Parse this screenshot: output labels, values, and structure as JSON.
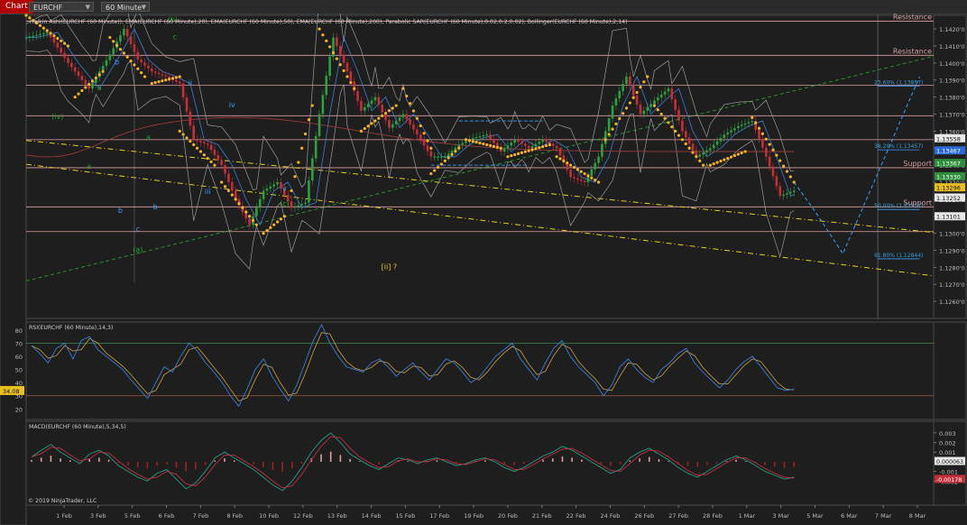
{
  "toolbar": {
    "chart_button": "Chart",
    "instrument": "EURCHF",
    "interval": "60 Minute"
  },
  "copyright": "© 2019 NinjaTrader, LLC",
  "colors": {
    "background": "#1e1e1e",
    "panel_border": "#4a4a4a",
    "sar": "#f5b324",
    "ema20": "#3a7dd8",
    "ema200": "#9a3a3a",
    "bollinger": "#9a9a9a",
    "candle_up": "#2ea043",
    "candle_down": "#c42f3a",
    "resistance_line": "#e0a0a0",
    "fib_line": "#3aa0ff",
    "trend_yellow": "#e8d020",
    "trend_green": "#2aa02a",
    "rsi_line": "#3a7dd8",
    "rsi_signal": "#d0a040",
    "macd_pos": "#e0a0a0",
    "macd_neg": "#a02020",
    "price_marker": "#ffffff",
    "support_marker": "#2ea043",
    "red_marker": "#c42f3a"
  },
  "chart_data": {
    "type": "candlestick",
    "title": "Heikin Ashi(EURCHF (60 Minute)), EMA(EURCHF (60 Minute),20), EMA(EURCHF (60 Minute),50), EMA(EURCHF (60 Minute),200), Parabolic SAR(EURCHF (60 Minute),0.02,0.2,0.02), Bollinger(EURCHF (60 Minute),2,14)",
    "x_labels": [
      "1 Feb",
      "3 Feb",
      "5 Feb",
      "6 Feb",
      "7 Feb",
      "8 Feb",
      "10 Feb",
      "12 Feb",
      "13 Feb",
      "14 Feb",
      "15 Feb",
      "17 Feb",
      "19 Feb",
      "20 Feb",
      "21 Feb",
      "22 Feb",
      "24 Feb",
      "26 Feb",
      "27 Feb",
      "28 Feb",
      "1 Mar",
      "3 Mar",
      "5 Mar",
      "6 Mar",
      "7 Mar",
      "8 Mar"
    ],
    "price_axis": {
      "ylim": [
        1.125,
        1.1428
      ],
      "ticks": [
        "1.1420'0",
        "1.1410'0",
        "1.1400'0",
        "1.1390'0",
        "1.1380'0",
        "1.1370'0",
        "1.1360'0",
        "1.1350'0",
        "1.1340'0",
        "1.1330'0",
        "1.1320'0",
        "1.1310'0",
        "1.1300'0",
        "1.1290'0",
        "1.1280'0",
        "1.1270'0",
        "1.1260'0"
      ],
      "tick_values": [
        1.142,
        1.141,
        1.14,
        1.139,
        1.138,
        1.137,
        1.136,
        1.135,
        1.134,
        1.133,
        1.132,
        1.131,
        1.13,
        1.129,
        1.128,
        1.127,
        1.126
      ]
    },
    "price_path": [
      [
        0,
        1.1415
      ],
      [
        3,
        1.1418
      ],
      [
        6,
        1.14
      ],
      [
        9,
        1.1385
      ],
      [
        12,
        1.1405
      ],
      [
        14,
        1.142
      ],
      [
        16,
        1.1402
      ],
      [
        18,
        1.1395
      ],
      [
        20,
        1.1392
      ],
      [
        22,
        1.1388
      ],
      [
        24,
        1.1355
      ],
      [
        26,
        1.1352
      ],
      [
        28,
        1.134
      ],
      [
        30,
        1.132
      ],
      [
        32,
        1.1305
      ],
      [
        34,
        1.1325
      ],
      [
        36,
        1.133
      ],
      [
        38,
        1.1315
      ],
      [
        40,
        1.1318
      ],
      [
        42,
        1.137
      ],
      [
        44,
        1.1415
      ],
      [
        46,
        1.1395
      ],
      [
        48,
        1.1372
      ],
      [
        50,
        1.138
      ],
      [
        52,
        1.1362
      ],
      [
        54,
        1.137
      ],
      [
        56,
        1.1358
      ],
      [
        58,
        1.1345
      ],
      [
        60,
        1.1345
      ],
      [
        62,
        1.1352
      ],
      [
        64,
        1.1356
      ],
      [
        66,
        1.1358
      ],
      [
        68,
        1.1348
      ],
      [
        70,
        1.1355
      ],
      [
        72,
        1.135
      ],
      [
        74,
        1.1355
      ],
      [
        76,
        1.135
      ],
      [
        78,
        1.1333
      ],
      [
        80,
        1.133
      ],
      [
        82,
        1.1345
      ],
      [
        84,
        1.1375
      ],
      [
        86,
        1.1392
      ],
      [
        88,
        1.137
      ],
      [
        90,
        1.1378
      ],
      [
        92,
        1.1385
      ],
      [
        94,
        1.136
      ],
      [
        96,
        1.1345
      ],
      [
        98,
        1.135
      ],
      [
        100,
        1.1358
      ],
      [
        102,
        1.1363
      ],
      [
        104,
        1.1366
      ],
      [
        106,
        1.1345
      ],
      [
        108,
        1.1322
      ],
      [
        110,
        1.1325
      ]
    ],
    "x_range": [
      0,
      130
    ],
    "sar_segments": [
      [
        [
          0,
          1.1428
        ],
        [
          6,
          1.141
        ]
      ],
      [
        [
          7,
          1.138
        ],
        [
          11,
          1.1395
        ]
      ],
      [
        [
          12,
          1.1415
        ],
        [
          17,
          1.1392
        ]
      ],
      [
        [
          18,
          1.1388
        ],
        [
          22,
          1.1392
        ]
      ],
      [
        [
          22,
          1.136
        ],
        [
          27,
          1.134
        ]
      ],
      [
        [
          28,
          1.133
        ],
        [
          33,
          1.1305
        ]
      ],
      [
        [
          34,
          1.13
        ],
        [
          37,
          1.131
        ]
      ],
      [
        [
          38,
          1.1325
        ],
        [
          41,
          1.1375
        ]
      ],
      [
        [
          42,
          1.142
        ],
        [
          47,
          1.1385
        ]
      ],
      [
        [
          48,
          1.136
        ],
        [
          53,
          1.1375
        ]
      ],
      [
        [
          54,
          1.1385
        ],
        [
          58,
          1.135
        ]
      ],
      [
        [
          58,
          1.1335
        ],
        [
          62,
          1.135
        ]
      ],
      [
        [
          63,
          1.1355
        ],
        [
          68,
          1.135
        ]
      ],
      [
        [
          69,
          1.1345
        ],
        [
          75,
          1.1352
        ]
      ],
      [
        [
          76,
          1.1345
        ],
        [
          82,
          1.133
        ]
      ],
      [
        [
          83,
          1.1355
        ],
        [
          89,
          1.1392
        ]
      ],
      [
        [
          90,
          1.1375
        ],
        [
          97,
          1.134
        ]
      ],
      [
        [
          98,
          1.134
        ],
        [
          103,
          1.1348
        ]
      ],
      [
        [
          104,
          1.1368
        ],
        [
          110,
          1.133
        ]
      ]
    ],
    "horizontal_levels": [
      {
        "value": 1.14245,
        "label": "Resistance"
      },
      {
        "value": 1.14045,
        "label": "Resistance"
      },
      {
        "value": 1.13385,
        "label": "Support"
      },
      {
        "value": 1.13155,
        "label": "Support"
      }
    ],
    "other_levels": [
      1.1387,
      1.1369,
      1.1355,
      1.1301
    ],
    "fib_levels": [
      {
        "value": 1.13865,
        "label": "23.60% (1.13857)"
      },
      {
        "value": 1.1349,
        "label": "38.20% (1.13457)"
      },
      {
        "value": 1.1314,
        "label": "50.00% (1.13151)"
      },
      {
        "value": 1.1285,
        "label": "61.80% (1.12844)"
      }
    ],
    "price_markers": [
      {
        "value": 1.13558,
        "label": "1.13558",
        "style": "white"
      },
      {
        "value": 1.13487,
        "label": "1.13467",
        "style": "blue"
      },
      {
        "value": 1.13413,
        "label": "1.13367",
        "style": "green"
      },
      {
        "value": 1.13335,
        "label": "1.13330",
        "style": "green"
      },
      {
        "value": 1.1327,
        "label": "1.13296",
        "style": "yellow"
      },
      {
        "value": 1.1321,
        "label": "1.13252",
        "style": "white"
      },
      {
        "value": 1.131,
        "label": "1.13101",
        "style": "white"
      }
    ],
    "wave_labels": [
      {
        "x": 21,
        "y": 1.1424,
        "text": "(b)",
        "color": "#2aa02a"
      },
      {
        "x": 21.3,
        "y": 1.1414,
        "text": "c",
        "color": "#2aa02a"
      },
      {
        "x": 9,
        "y": 1.1338,
        "text": "a",
        "color": "#2aa02a"
      },
      {
        "x": 13,
        "y": 1.1399,
        "text": "b",
        "color": "#3aa0ff"
      },
      {
        "x": 13.5,
        "y": 1.1312,
        "text": "b",
        "color": "#3aa0ff"
      },
      {
        "x": 17.5,
        "y": 1.1355,
        "text": "a",
        "color": "#2aa02a"
      },
      {
        "x": 18.5,
        "y": 1.1314,
        "text": "b",
        "color": "#3aa0ff"
      },
      {
        "x": 16,
        "y": 1.1301,
        "text": "c",
        "color": "#3aa0ff"
      },
      {
        "x": 16,
        "y": 1.1289,
        "text": "(a)",
        "color": "#2aa02a"
      },
      {
        "x": 4.5,
        "y": 1.1367,
        "text": "(iv)",
        "color": "#2aa02a"
      },
      {
        "x": 10.5,
        "y": 1.1384,
        "text": "a",
        "color": "#2aa02a"
      },
      {
        "x": 23.5,
        "y": 1.1387,
        "text": "ii",
        "color": "#3aa0ff"
      },
      {
        "x": 22.5,
        "y": 1.1355,
        "text": "i",
        "color": "#3aa0ff"
      },
      {
        "x": 29.5,
        "y": 1.1374,
        "text": "iv",
        "color": "#3aa0ff"
      },
      {
        "x": 26,
        "y": 1.1323,
        "text": "iii",
        "color": "#3aa0ff"
      },
      {
        "x": 37,
        "y": 1.1325,
        "text": "v",
        "color": "#3aa0ff"
      },
      {
        "x": 37,
        "y": 1.1316,
        "text": "(c)",
        "color": "#2aa02a"
      },
      {
        "x": 52,
        "y": 1.1279,
        "text": "[ii] ?",
        "color": "#e8d020"
      }
    ],
    "rsi": {
      "title": "RSI(EURCHF (60 Minute),14,3)",
      "ylim": [
        12,
        86
      ],
      "ticks": [
        20,
        30,
        40,
        50,
        60,
        70,
        80
      ],
      "levels": [
        30,
        70
      ],
      "current": "34.08",
      "values": [
        68,
        62,
        55,
        66,
        70,
        58,
        72,
        75,
        65,
        60,
        55,
        50,
        42,
        35,
        28,
        40,
        52,
        48,
        60,
        70,
        64,
        55,
        48,
        40,
        30,
        22,
        35,
        50,
        58,
        45,
        35,
        26,
        38,
        55,
        72,
        84,
        70,
        60,
        52,
        50,
        48,
        55,
        58,
        52,
        45,
        50,
        55,
        48,
        42,
        50,
        58,
        55,
        48,
        40,
        44,
        52,
        60,
        65,
        70,
        58,
        50,
        42,
        55,
        66,
        72,
        60,
        52,
        46,
        40,
        30,
        38,
        52,
        58,
        50,
        44,
        40,
        50,
        55,
        62,
        66,
        55,
        48,
        42,
        36,
        42,
        50,
        56,
        60,
        52,
        44,
        36,
        34,
        35
      ]
    },
    "macd": {
      "title": "MACD(EURCHF (60 Minute),5,34,5)",
      "ylim": [
        -0.0045,
        0.0042
      ],
      "ticks": [
        "0.003",
        "0.002",
        "0.001",
        "-0.001",
        "-0.002"
      ],
      "tick_values": [
        0.003,
        0.002,
        0.001,
        -0.001,
        -0.002
      ],
      "markers": [
        {
          "value": 8e-05,
          "label": "0.000063",
          "style": "white"
        },
        {
          "value": -0.00178,
          "label": "-0.00178",
          "style": "red"
        }
      ],
      "values": [
        0.0005,
        0.0012,
        0.0018,
        0.001,
        0.0004,
        -0.0002,
        0.0008,
        0.0012,
        0.0006,
        -0.0004,
        -0.001,
        -0.0016,
        -0.002,
        -0.0012,
        -0.0008,
        -0.0018,
        -0.0028,
        -0.0022,
        -0.001,
        0.0004,
        0.001,
        0.0004,
        -0.0002,
        -0.0008,
        -0.0016,
        -0.0024,
        -0.003,
        -0.002,
        -0.0006,
        0.001,
        0.0022,
        0.003,
        0.002,
        0.0008,
        0.0002,
        -0.0004,
        -0.0008,
        -0.0002,
        0.0004,
        0.0002,
        -0.0002,
        0.0002,
        0.0004,
        0.0,
        -0.0004,
        -0.0002,
        0.0002,
        0.0004,
        0.0,
        -0.0006,
        -0.001,
        -0.0006,
        0.0,
        0.0006,
        0.001,
        0.0016,
        0.0012,
        0.0006,
        0.0,
        -0.0006,
        -0.0012,
        -0.0008,
        0.0004,
        0.001,
        0.0014,
        0.0008,
        0.0002,
        -0.0006,
        -0.0012,
        -0.0016,
        -0.001,
        -0.0004,
        0.0002,
        0.0006,
        0.0002,
        -0.0004,
        -0.001,
        -0.0014,
        -0.0018,
        -0.0016
      ]
    }
  }
}
